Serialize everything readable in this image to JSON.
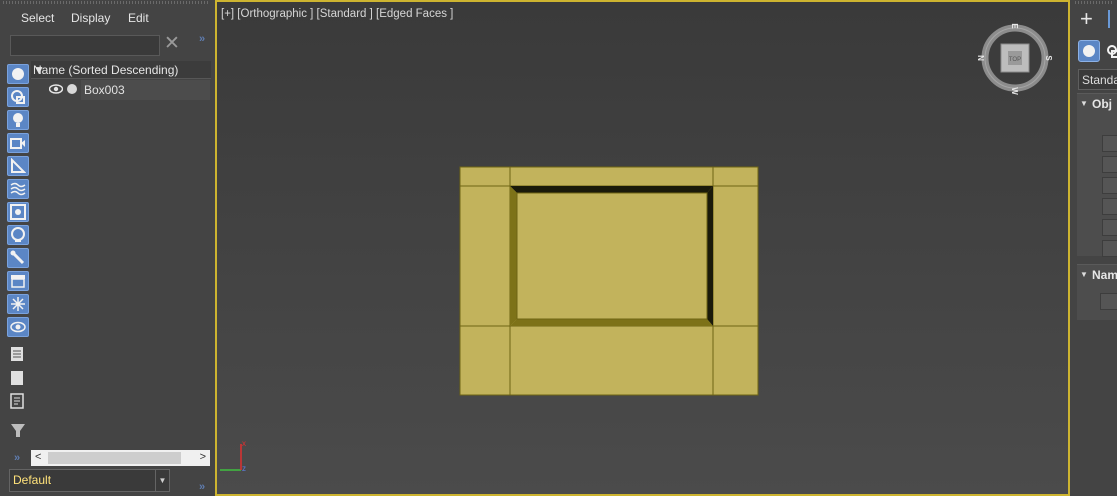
{
  "menubar": {
    "items": [
      "Select",
      "Display",
      "Edit"
    ]
  },
  "search": {
    "value": "",
    "placeholder": ""
  },
  "list": {
    "column_header": "Name (Sorted Descending)",
    "rows": [
      {
        "name": "Box003"
      }
    ]
  },
  "filter_icons": [
    "geometry-filter-icon",
    "shapes-filter-icon",
    "lights-filter-icon",
    "cameras-filter-icon",
    "helpers-filter-icon",
    "space-warps-filter-icon",
    "groups-filter-icon",
    "xrefs-filter-icon",
    "bones-filter-icon",
    "containers-filter-icon",
    "frozen-filter-icon",
    "hidden-filter-icon"
  ],
  "layer": {
    "value": "Default"
  },
  "viewport": {
    "label": "[+] [Orthographic ] [Standard ] [Edged Faces ]",
    "viewcube": {
      "face": "top",
      "compass": [
        "N",
        "E",
        "S",
        "W"
      ]
    },
    "axis": [
      "x",
      "z"
    ]
  },
  "command_panel": {
    "dropdown_value": "Standa",
    "rollouts": [
      "Obj",
      "Nam"
    ]
  },
  "colors": {
    "accent": "#5b86c5",
    "viewport_border": "#cdb430",
    "object_fill": "#c2b35c",
    "object_edge": "#6e6414",
    "layer_text": "#ffe27a"
  }
}
